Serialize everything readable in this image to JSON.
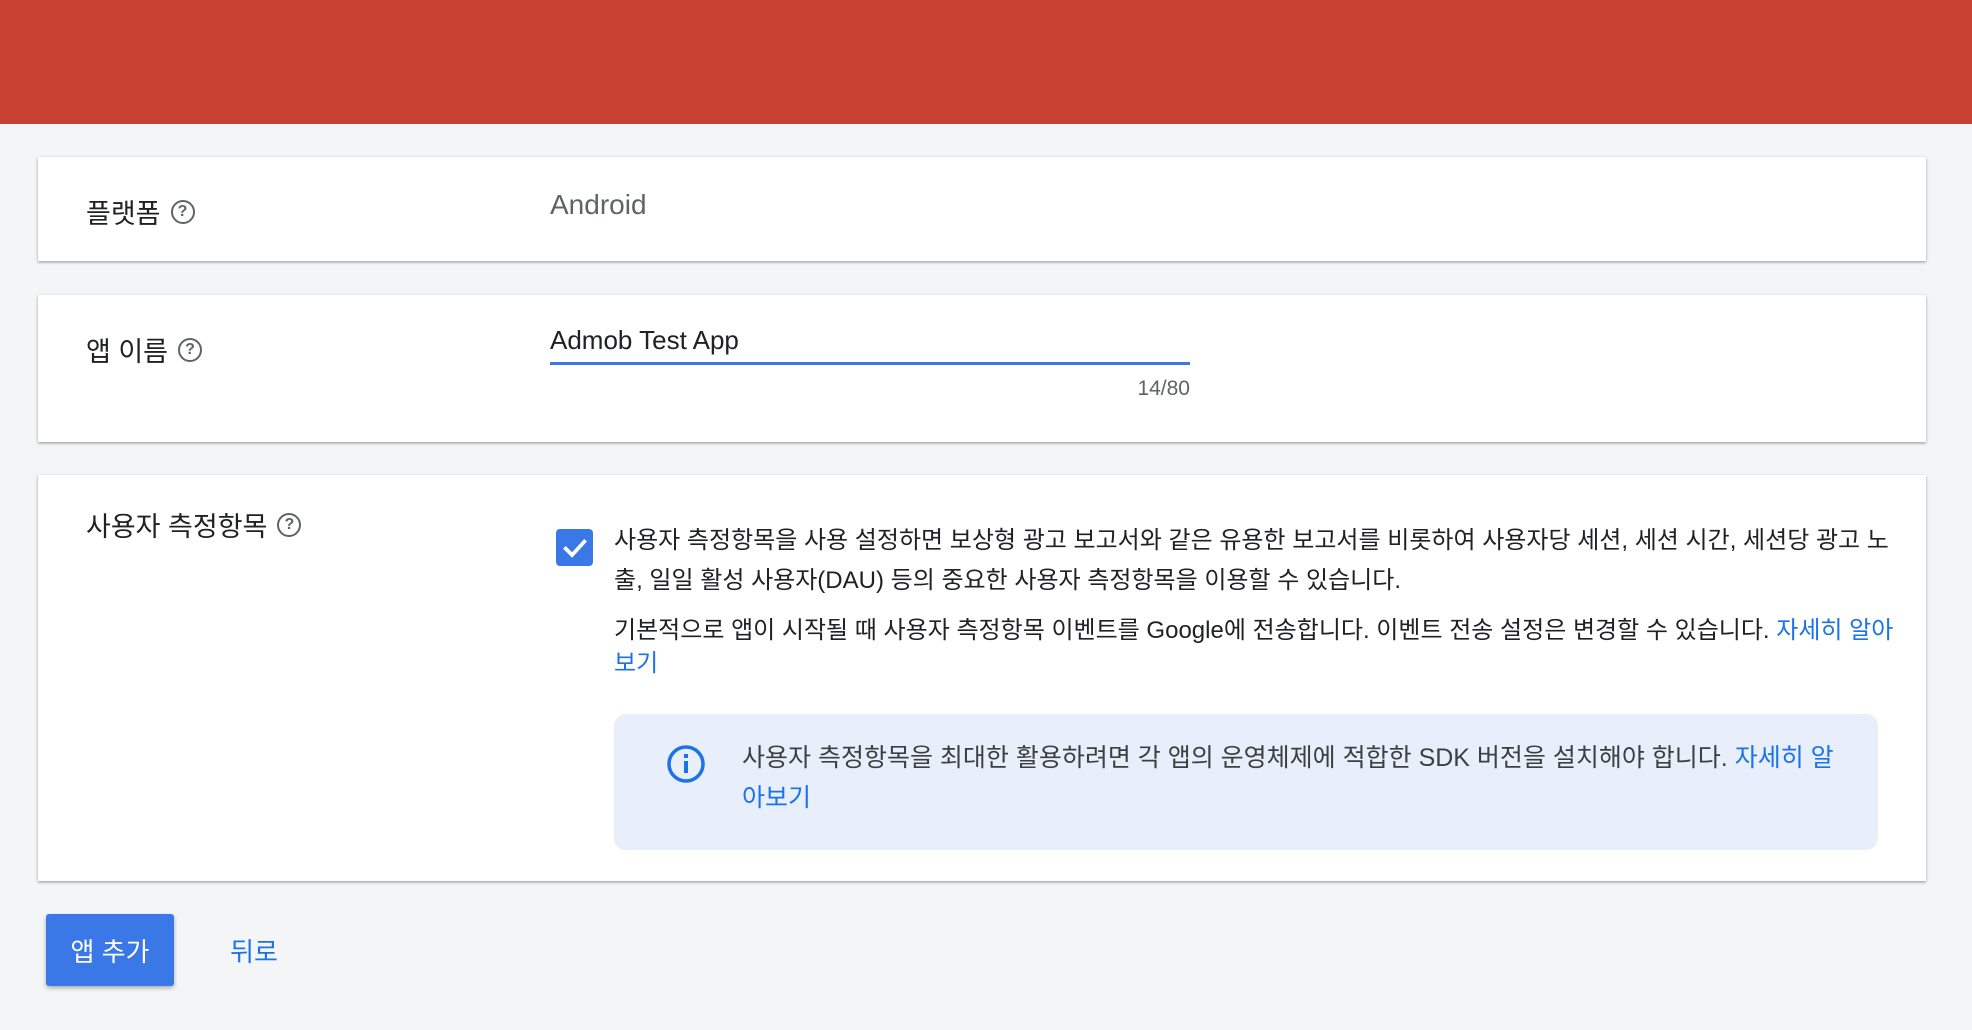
{
  "colors": {
    "header_bar": "#c94132",
    "accent": "#3b78e7",
    "link": "#1a73e8",
    "info_bg": "#e8eefa"
  },
  "platform": {
    "label": "플랫폼",
    "value": "Android",
    "help_icon": "help-circle-icon"
  },
  "app_name": {
    "label": "앱 이름",
    "value": "Admob Test App",
    "counter": "14/80",
    "help_icon": "help-circle-icon"
  },
  "user_metrics": {
    "label": "사용자 측정항목",
    "checked": true,
    "description": "사용자 측정항목을 사용 설정하면 보상형 광고 보고서와 같은 유용한 보고서를 비롯하여 사용자당 세션, 세션 시간, 세션당 광고 노출, 일일 활성 사용자(DAU) 등의 중요한 사용자 측정항목을 이용할 수 있습니다.",
    "default_note": "기본적으로 앱이 시작될 때 사용자 측정항목 이벤트를 Google에 전송합니다. 이벤트 전송 설정은 변경할 수 있습니다. ",
    "learn_more": "자세히 알아보기",
    "info": {
      "icon": "info-icon",
      "text": "사용자 측정항목을 최대한 활용하려면 각 앱의 운영체제에 적합한 SDK 버전을 설치해야 합니다. ",
      "learn_more": "자세히 알아보기"
    }
  },
  "actions": {
    "add_app": "앱 추가",
    "back": "뒤로"
  }
}
